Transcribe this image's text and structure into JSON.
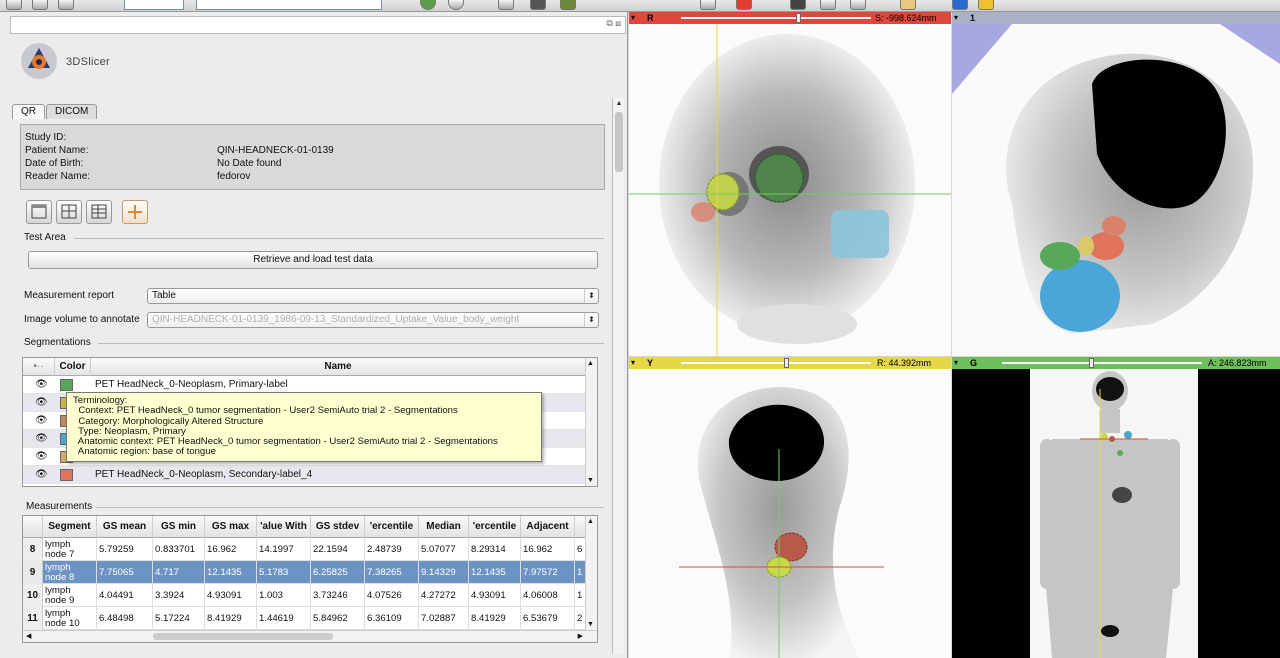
{
  "app": {
    "logo_text": "3DSlicer"
  },
  "tabs": [
    {
      "label": "QR",
      "active": true
    },
    {
      "label": "DICOM",
      "active": false
    }
  ],
  "patient": {
    "labels": [
      "Study ID:",
      "Patient Name:",
      "Date of Birth:",
      "Reader Name:"
    ],
    "values": [
      "",
      "QIN-HEADNECK-01-0139",
      "No Date found",
      "fedorov"
    ]
  },
  "test_area": {
    "title": "Test Area",
    "button": "Retrieve and load test data"
  },
  "measurement_report": {
    "label": "Measurement report",
    "value": "Table"
  },
  "image_volume": {
    "label": "Image volume to annotate",
    "value": "QIN-HEADNECK-01-0139_1986-09-13_Standardized_Uptake_Value_body_weight"
  },
  "segmentations": {
    "title": "Segmentations",
    "headers": [
      "Color",
      "Name"
    ],
    "rows": [
      {
        "color": "#58a85a",
        "name": "PET HeadNeck_0-Neoplasm, Primary-label"
      },
      {
        "color": "#c9b44a",
        "name": ""
      },
      {
        "color": "#b98a5c",
        "name": ""
      },
      {
        "color": "#4aa6c9",
        "name": ""
      },
      {
        "color": "#d9a86a",
        "name": ""
      },
      {
        "color": "#e0735a",
        "name": "PET HeadNeck_0-Neoplasm, Secondary-label_4"
      }
    ]
  },
  "tooltip": {
    "lines": [
      "Terminology:",
      "  Context: PET HeadNeck_0 tumor segmentation - User2 SemiAuto trial 2 - Segmentations",
      "  Category: Morphologically Altered Structure",
      "  Type: Neoplasm, Primary",
      "  Anatomic context: PET HeadNeck_0 tumor segmentation - User2 SemiAuto trial 2 - Segmentations",
      "  Anatomic region: base of tongue"
    ]
  },
  "measurements": {
    "title": "Measurements",
    "headers": [
      "Segment",
      "GS mean",
      "GS min",
      "GS max",
      "'alue With",
      "GS stdev",
      "'ercentile",
      "Median",
      "'ercentile",
      "Adjacent",
      ""
    ],
    "rows": [
      {
        "idx": "8",
        "seg1": "lymph",
        "seg2": "node 7",
        "vals": [
          "5.79259",
          "0.833701",
          "16.962",
          "14.1997",
          "22.1594",
          "2.48739",
          "5.07077",
          "8.29314",
          "16.962",
          "6"
        ]
      },
      {
        "idx": "9",
        "seg1": "lymph",
        "seg2": "node 8",
        "vals": [
          "7.75065",
          "4.717",
          "12.1435",
          "5.1783",
          "6.25825",
          "7.38265",
          "9.14329",
          "12.1435",
          "7.97572",
          "1"
        ],
        "selected": true
      },
      {
        "idx": "10",
        "seg1": "lymph",
        "seg2": "node 9",
        "vals": [
          "4.04491",
          "3.3924",
          "4.93091",
          "1.003",
          "3.73246",
          "4.07526",
          "4.27272",
          "4.93091",
          "4.06008",
          "1"
        ]
      },
      {
        "idx": "11",
        "seg1": "lymph",
        "seg2": "node 10",
        "vals": [
          "6.48498",
          "5.17224",
          "8.41929",
          "1.44619",
          "5.84962",
          "6.36109",
          "7.02887",
          "8.41929",
          "6.53679",
          "2"
        ]
      }
    ]
  },
  "viewers": {
    "red": {
      "letter": "R",
      "readout": "S: -998.624mm",
      "color": "#e0473c",
      "slider": 0.62
    },
    "three_d": {
      "letter": "1",
      "readout": "",
      "color": "#9aa0b8"
    },
    "yellow": {
      "letter": "Y",
      "readout": "R: 44.392mm",
      "color": "#e6d64a",
      "slider": 0.56
    },
    "green": {
      "letter": "G",
      "readout": "A: 246.823mm",
      "color": "#6cbf5a",
      "slider": 0.45
    }
  },
  "icons": {
    "eye": "eye-icon",
    "caret": "dropdown-caret-icon",
    "dock": "float-undock-icon"
  }
}
